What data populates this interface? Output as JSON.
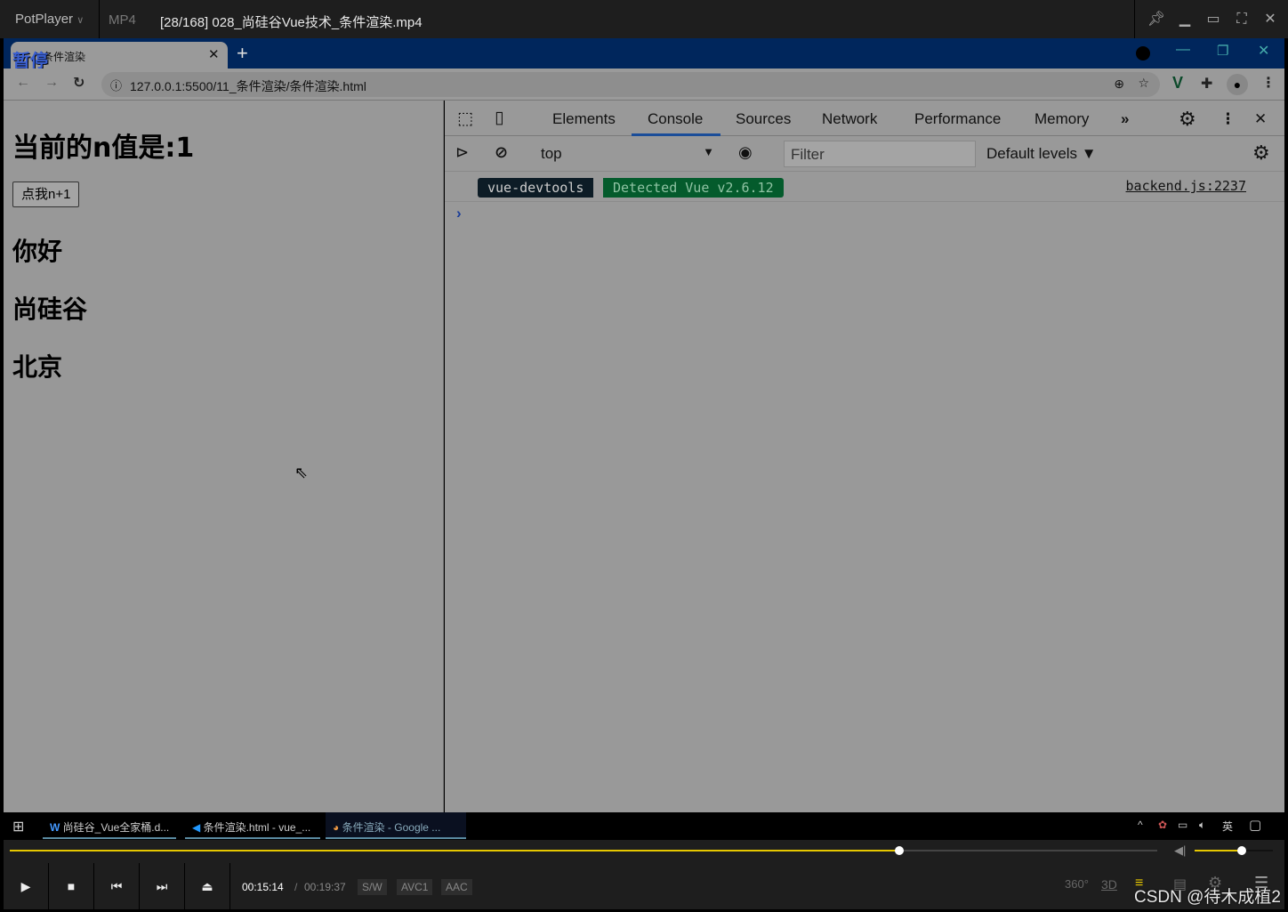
{
  "player": {
    "brand": "PotPlayer",
    "format": "MP4",
    "title": "[28/168] 028_尚硅谷Vue技术_条件渲染.mp4",
    "pause_overlay": "暂停"
  },
  "browser": {
    "tab_title": "条件渲染",
    "url": "127.0.0.1:5500/11_条件渲染/条件渲染.html"
  },
  "page": {
    "heading": "当前的n值是:1",
    "button": "点我n+1",
    "lines": [
      "你好",
      "尚硅谷",
      "北京"
    ]
  },
  "devtools": {
    "tabs": [
      "Elements",
      "Console",
      "Sources",
      "Network",
      "Performance",
      "Memory"
    ],
    "active_tab": "Console",
    "context": "top",
    "filter_placeholder": "Filter",
    "levels": "Default levels ▼",
    "message": {
      "badge": "vue-devtools",
      "text": "Detected Vue v2.6.12",
      "source": "backend.js:2237"
    },
    "prompt": "›"
  },
  "taskbar": {
    "items": [
      "尚硅谷_Vue全家桶.d...",
      "条件渲染.html - vue_...",
      "条件渲染 - Google ..."
    ],
    "ime": "英"
  },
  "playback": {
    "current": "00:15:14",
    "separator": "/",
    "total": "00:19:37",
    "tags": [
      "S/W",
      "AVC1",
      "AAC"
    ],
    "progress": 0.775,
    "volume": 0.6,
    "accent": "#e6c700",
    "extra": [
      "360°",
      "3D"
    ]
  },
  "watermark": "CSDN @待木成植2"
}
